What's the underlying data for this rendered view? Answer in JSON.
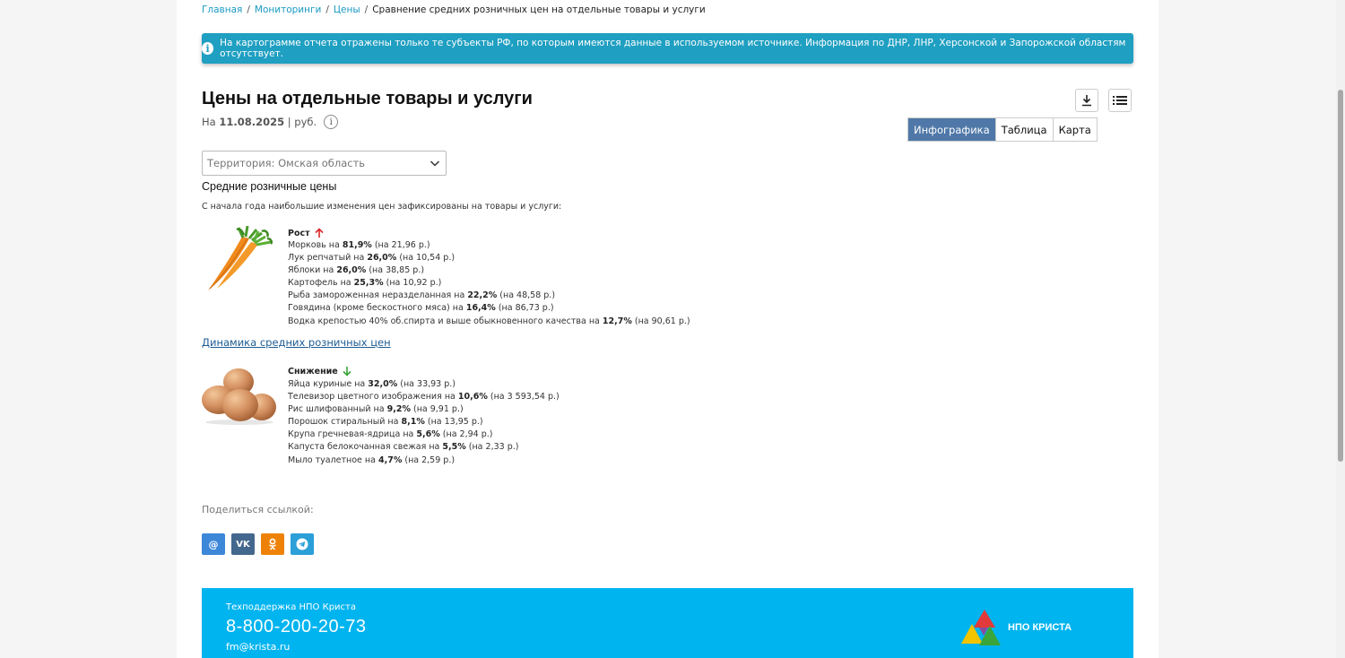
{
  "breadcrumb": {
    "items": [
      "Главная",
      "Мониторинги",
      "Цены"
    ],
    "current": "Сравнение средних розничных цен на отдельные товары и услуги"
  },
  "alert": {
    "text": "На картограмме отчета отражены только те субъекты РФ, по которым имеются данные в используемом источнике. Информация по ДНР, ЛНР, Херсонской и Запорожской областям отсутствует."
  },
  "header": {
    "title": "Цены на отдельные товары и услуги",
    "date_prefix": "На",
    "date": "11.08.2025",
    "unit": "| руб."
  },
  "view_tabs": [
    {
      "label": "Инфографика",
      "active": true
    },
    {
      "label": "Таблица",
      "active": false
    },
    {
      "label": "Карта",
      "active": false
    }
  ],
  "territory": {
    "value": "Территория: Омская область"
  },
  "section": {
    "title": "Средние розничные цены",
    "subtitle": "С начала года наибольшие изменения цен зафиксированы на товары и услуги:"
  },
  "growth": {
    "label": "Рост",
    "items": [
      {
        "name": "Морковь на ",
        "pct": "81,9%",
        "abs": " (на 21,96 р.)"
      },
      {
        "name": "Лук репчатый на ",
        "pct": "26,0%",
        "abs": " (на 10,54 р.)"
      },
      {
        "name": "Яблоки на ",
        "pct": "26,0%",
        "abs": " (на 38,85 р.)"
      },
      {
        "name": "Картофель на ",
        "pct": "25,3%",
        "abs": " (на 10,92 р.)"
      },
      {
        "name": "Рыба замороженная неразделанная на ",
        "pct": "22,2%",
        "abs": " (на 48,58 р.)"
      },
      {
        "name": "Говядина (кроме бескостного мяса) на ",
        "pct": "16,4%",
        "abs": " (на 86,73 р.)"
      },
      {
        "name": "Водка крепостью 40% об.спирта и выше обыкновенного качества на ",
        "pct": "12,7%",
        "abs": " (на 90,61 р.)"
      }
    ]
  },
  "dynamics_link": "Динамика средних розничных цен",
  "decline": {
    "label": "Снижение",
    "items": [
      {
        "name": "Яйца куриные на ",
        "pct": "32,0%",
        "abs": " (на 33,93 р.)"
      },
      {
        "name": "Телевизор цветного изображения на ",
        "pct": "10,6%",
        "abs": " (на 3 593,54 р.)"
      },
      {
        "name": "Рис шлифованный на ",
        "pct": "9,2%",
        "abs": " (на 9,91 р.)"
      },
      {
        "name": "Порошок стиральный на ",
        "pct": "8,1%",
        "abs": " (на 13,95 р.)"
      },
      {
        "name": "Крупа гречневая-ядрица на ",
        "pct": "5,6%",
        "abs": " (на 2,94 р.)"
      },
      {
        "name": "Капуста белокочанная свежая на ",
        "pct": "5,5%",
        "abs": " (на 2,33 р.)"
      },
      {
        "name": "Мыло туалетное на ",
        "pct": "4,7%",
        "abs": " (на 2,59 р.)"
      }
    ]
  },
  "share": {
    "label": "Поделиться ссылкой:",
    "buttons": [
      {
        "icon": "mail-icon",
        "glyph": "@",
        "color": "#3d87d8"
      },
      {
        "icon": "vk-icon",
        "glyph": "vk",
        "color": "#44678d"
      },
      {
        "icon": "ok-icon",
        "glyph": "ok",
        "color": "#ee8208"
      },
      {
        "icon": "telegram-icon",
        "glyph": "tg",
        "color": "#2a9fd8"
      }
    ]
  },
  "footer": {
    "label": "Техподдержка НПО Криста",
    "phone": "8-800-200-20-73",
    "email": "fm@krista.ru",
    "logo_text": "НПО КРИСТА"
  },
  "colors": {
    "accent": "#1f9fc1",
    "active_tab": "#4f78a8",
    "footer": "#00b4ef",
    "growth_arrow": "#d9262a",
    "decline_arrow": "#3aa53a"
  }
}
